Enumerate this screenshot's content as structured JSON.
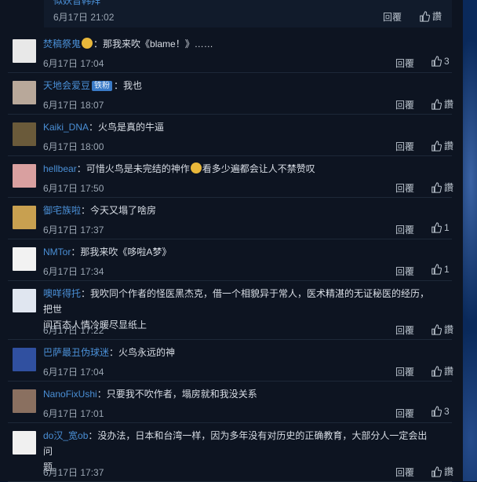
{
  "top_reply": {
    "name": "似妖音韩拜",
    "time": "6月17日 21:02",
    "reply_label": "回覆",
    "like_label": "讚"
  },
  "comments": [
    {
      "user": "焚稿祭鬼",
      "badge": "",
      "emoji": true,
      "text": "：那我来吹《blame！》……",
      "text2": "",
      "time": "6月17日 17:04",
      "reply": "回覆",
      "like": "3",
      "avatar_color": "#e8e8e8"
    },
    {
      "user": "天地会爱豆",
      "badge": "铁粉",
      "emoji": false,
      "text": "：我也",
      "text2": "",
      "time": "6月17日 18:07",
      "reply": "回覆",
      "like": "讚",
      "avatar_color": "#b8a89a"
    },
    {
      "user": "Kaiki_DNA",
      "badge": "",
      "emoji": false,
      "text": "：火鸟是真的牛逼",
      "text2": "",
      "time": "6月17日 18:00",
      "reply": "回覆",
      "like": "讚",
      "avatar_color": "#6a5a3a"
    },
    {
      "user": "hellbear",
      "badge": "",
      "emoji": true,
      "text": "：可惜火鸟是未完结的神作",
      "text_after": "看多少遍都会让人不禁赞叹",
      "text2": "",
      "time": "6月17日 17:50",
      "reply": "回覆",
      "like": "讚",
      "avatar_color": "#d9a0a0"
    },
    {
      "user": "御宅族啦",
      "badge": "",
      "emoji": false,
      "text": "：今天又塌了啥房",
      "text2": "",
      "time": "6月17日 17:37",
      "reply": "回覆",
      "like": "1",
      "avatar_color": "#c8a050"
    },
    {
      "user": "NMTor",
      "badge": "",
      "emoji": false,
      "text": "：那我来吹《哆啦A梦》",
      "text2": "",
      "time": "6月17日 17:34",
      "reply": "回覆",
      "like": "1",
      "avatar_color": "#f2f2f2"
    },
    {
      "user": "噢咩得托",
      "badge": "",
      "emoji": false,
      "text": "：我吹同个作者的怪医黑杰克，借一个相貌异于常人，医术精湛的无证秘医的经历，把世",
      "text2": "间百态人情冷暖尽显纸上",
      "time": "6月17日 17:22",
      "reply": "回覆",
      "like": "讚",
      "avatar_color": "#e0e6f0"
    },
    {
      "user": "巴萨最丑伪球迷",
      "badge": "",
      "emoji": false,
      "text": "：火鸟永远的神",
      "text2": "",
      "time": "6月17日 17:04",
      "reply": "回覆",
      "like": "讚",
      "avatar_color": "#3050a0"
    },
    {
      "user": "NanoFixUshi",
      "badge": "",
      "emoji": false,
      "text": "：只要我不吹作者，塌房就和我没关系",
      "text2": "",
      "time": "6月17日 17:01",
      "reply": "回覆",
      "like": "3",
      "avatar_color": "#8a7060"
    },
    {
      "user": "do汉_宽ob",
      "badge": "",
      "emoji": false,
      "text": "：没办法，日本和台湾一样，因为多年没有对历史的正确教育，大部分人一定会出问",
      "text2": "题。",
      "time": "6月17日 17:37",
      "reply": "回覆",
      "like": "讚",
      "avatar_color": "#f0f0f0"
    }
  ],
  "colors": {
    "username": "#4a8fd6",
    "text": "#d9dee6",
    "meta": "#9ba6b3",
    "panel": "#0d1421"
  }
}
